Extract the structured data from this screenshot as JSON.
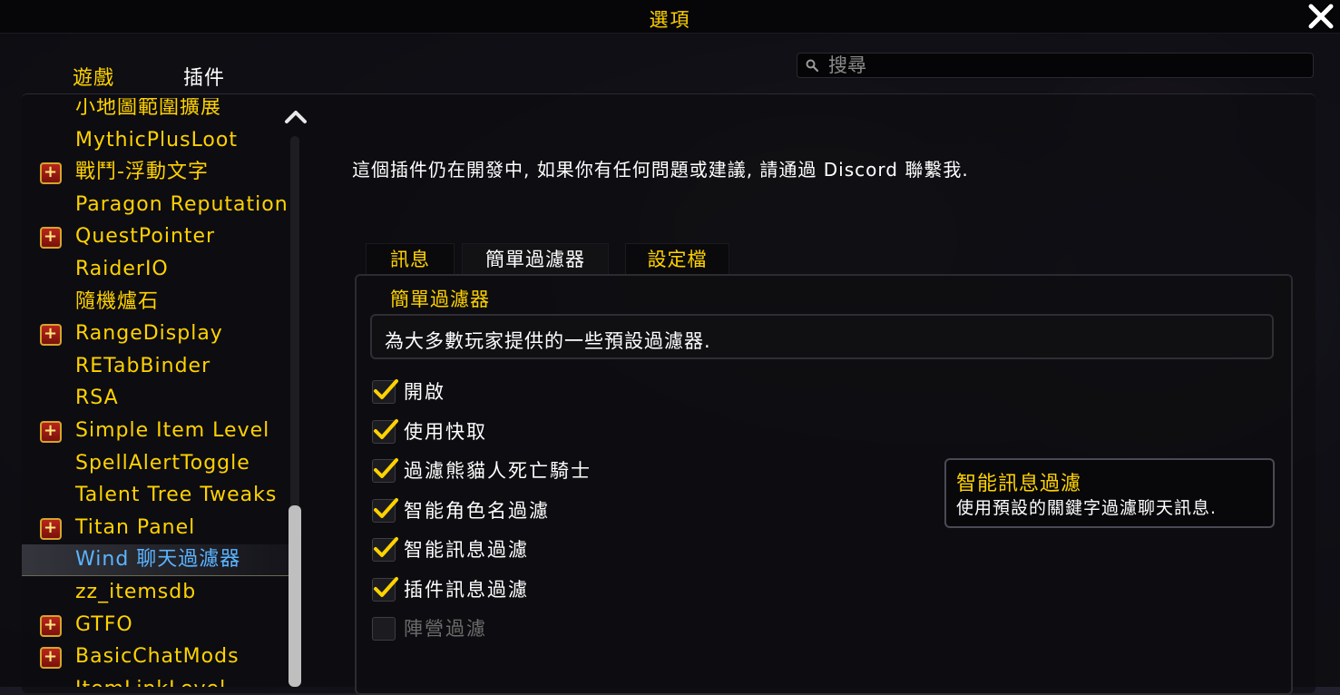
{
  "window": {
    "title": "選項",
    "close_label": "✕"
  },
  "top_tabs": [
    {
      "label": "遊戲"
    },
    {
      "label": "插件"
    }
  ],
  "search": {
    "placeholder": "搜尋",
    "value": ""
  },
  "addon_list": {
    "items": [
      {
        "label": "小地圖範圍擴展",
        "expandable": false,
        "selected": false
      },
      {
        "label": "MythicPlusLoot",
        "expandable": false,
        "selected": false
      },
      {
        "label": "戰鬥-浮動文字",
        "expandable": true,
        "selected": false
      },
      {
        "label": "Paragon Reputation",
        "expandable": false,
        "selected": false
      },
      {
        "label": "QuestPointer",
        "expandable": true,
        "selected": false
      },
      {
        "label": "RaiderIO",
        "expandable": false,
        "selected": false
      },
      {
        "label": "隨機爐石",
        "expandable": false,
        "selected": false
      },
      {
        "label": "RangeDisplay",
        "expandable": true,
        "selected": false
      },
      {
        "label": "RETabBinder",
        "expandable": false,
        "selected": false
      },
      {
        "label": "RSA",
        "expandable": false,
        "selected": false
      },
      {
        "label": "Simple Item Level",
        "expandable": true,
        "selected": false
      },
      {
        "label": "SpellAlertToggle",
        "expandable": false,
        "selected": false
      },
      {
        "label": "Talent Tree Tweaks",
        "expandable": false,
        "selected": false
      },
      {
        "label": "Titan Panel",
        "expandable": true,
        "selected": false
      },
      {
        "label": "Wind 聊天過濾器",
        "expandable": false,
        "selected": true
      },
      {
        "label": "zz_itemsdb",
        "expandable": false,
        "selected": false
      },
      {
        "label": "GTFO",
        "expandable": true,
        "selected": false
      },
      {
        "label": "BasicChatMods",
        "expandable": true,
        "selected": false
      },
      {
        "label": "ItemLinkLevel",
        "expandable": false,
        "selected": false
      }
    ]
  },
  "main": {
    "info_text": "這個插件仍在開發中, 如果你有任何問題或建議, 請通過 Discord 聯繫我.",
    "tabs": [
      {
        "label": "訊息"
      },
      {
        "label": "簡單過濾器"
      },
      {
        "label": "設定檔"
      }
    ],
    "section_title": "簡單過濾器",
    "description": "為大多數玩家提供的一些預設過濾器.",
    "options": [
      {
        "label": "開啟",
        "checked": true,
        "enabled": true
      },
      {
        "label": "使用快取",
        "checked": true,
        "enabled": true
      },
      {
        "label": "過濾熊貓人死亡騎士",
        "checked": true,
        "enabled": true
      },
      {
        "label": "智能角色名過濾",
        "checked": true,
        "enabled": true
      },
      {
        "label": "智能訊息過濾",
        "checked": true,
        "enabled": true
      },
      {
        "label": "插件訊息過濾",
        "checked": true,
        "enabled": true
      },
      {
        "label": "陣營過濾",
        "checked": false,
        "enabled": false
      }
    ]
  },
  "tooltip": {
    "title": "智能訊息過濾",
    "body": "使用預設的關鍵字過濾聊天訊息."
  },
  "colors": {
    "accent": "#ffd200",
    "selected_text": "#5ab4ff",
    "disabled_text": "#6c6c6c"
  }
}
